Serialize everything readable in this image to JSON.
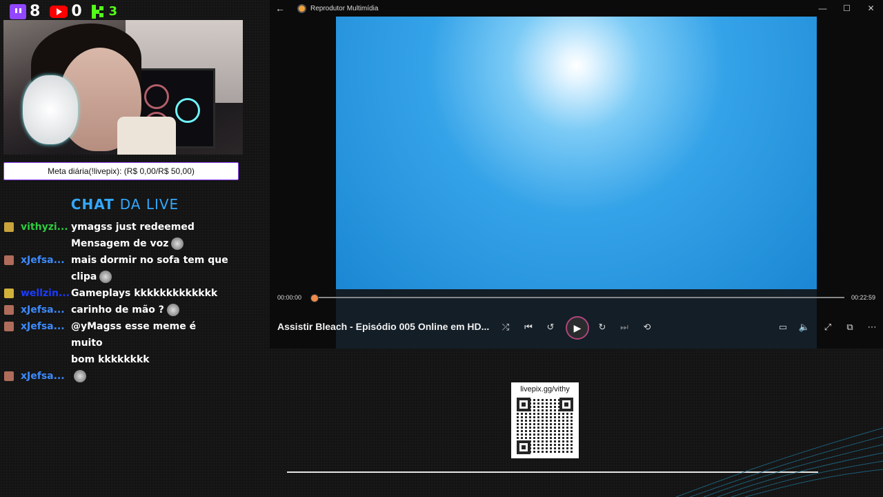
{
  "stats": {
    "twitch_count": "8",
    "youtube_count": "0",
    "kick_count": "3"
  },
  "meta_bar": {
    "text": "Meta diária(!livepix): (R$ 0,00/R$ 50,00)"
  },
  "chat_title": {
    "part1": "CHAT",
    "part2": "DA LIVE"
  },
  "chat": [
    {
      "nick": "vithyzi...",
      "nick_color": "#2ecc40",
      "badge_color": "#c9a33b",
      "text": "ymagss just redeemed"
    },
    {
      "nick": "",
      "nick_color": "#2ecc40",
      "badge_color": "",
      "text": "Mensagem de voz"
    },
    {
      "nick": "xJefsa...",
      "nick_color": "#3d8bff",
      "badge_color": "#b06c5a",
      "text": "mais dormir no sofa tem que"
    },
    {
      "nick": "",
      "nick_color": "#3d8bff",
      "badge_color": "",
      "text": "clipa"
    },
    {
      "nick": "wellzin...",
      "nick_color": "#1b3bff",
      "badge_color": "#d1b13a",
      "text": "Gameplays kkkkkkkkkkkkk"
    },
    {
      "nick": "xJefsa...",
      "nick_color": "#3d8bff",
      "badge_color": "#b06c5a",
      "text": "carinho de mão ?"
    },
    {
      "nick": "xJefsa...",
      "nick_color": "#3d8bff",
      "badge_color": "#b06c5a",
      "text": "@yMagss esse meme é muito"
    },
    {
      "nick": "",
      "nick_color": "#3d8bff",
      "badge_color": "",
      "text": "bom kkkkkkkk"
    },
    {
      "nick": "xJefsa...",
      "nick_color": "#3d8bff",
      "badge_color": "#b06c5a",
      "text": ""
    }
  ],
  "player": {
    "app_title": "Reprodutor Multimídia",
    "time_current": "00:00:00",
    "time_total": "00:22:59",
    "progress": 0,
    "video_title": "Assistir Bleach - Episódio 005 Online em HD...",
    "accent": "#f08a4b"
  },
  "qr": {
    "label": "livepix.gg/vithy"
  }
}
